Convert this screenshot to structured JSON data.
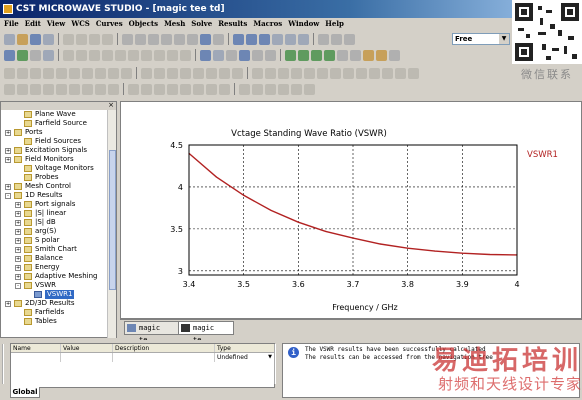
{
  "window": {
    "title": "CST MICROWAVE STUDIO - [magic tee td]"
  },
  "menu": [
    "File",
    "Edit",
    "View",
    "WCS",
    "Curves",
    "Objects",
    "Mesh",
    "Solve",
    "Results",
    "Macros",
    "Window",
    "Help"
  ],
  "toolbar": {
    "combo_value": "Free"
  },
  "watermark_top": {
    "caption": "微信联系"
  },
  "tree": {
    "items": [
      {
        "label": "Plane Wave",
        "level": 1,
        "expander": ""
      },
      {
        "label": "Farfield Source",
        "level": 1,
        "expander": ""
      },
      {
        "label": "Ports",
        "level": 0,
        "expander": "+"
      },
      {
        "label": "Field Sources",
        "level": 1,
        "expander": ""
      },
      {
        "label": "Excitation Signals",
        "level": 0,
        "expander": "+"
      },
      {
        "label": "Field Monitors",
        "level": 0,
        "expander": "+"
      },
      {
        "label": "Voltage Monitors",
        "level": 1,
        "expander": ""
      },
      {
        "label": "Probes",
        "level": 1,
        "expander": ""
      },
      {
        "label": "Mesh Control",
        "level": 0,
        "expander": "+"
      },
      {
        "label": "1D Results",
        "level": 0,
        "expander": "-"
      },
      {
        "label": "Port signals",
        "level": 1,
        "expander": "+"
      },
      {
        "label": "|S| linear",
        "level": 1,
        "expander": "+"
      },
      {
        "label": "|S| dB",
        "level": 1,
        "expander": "+"
      },
      {
        "label": "arg(S)",
        "level": 1,
        "expander": "+"
      },
      {
        "label": "S polar",
        "level": 1,
        "expander": "+"
      },
      {
        "label": "Smith Chart",
        "level": 1,
        "expander": "+"
      },
      {
        "label": "Balance",
        "level": 1,
        "expander": "+"
      },
      {
        "label": "Energy",
        "level": 1,
        "expander": "+"
      },
      {
        "label": "Adaptive Meshing",
        "level": 1,
        "expander": "+"
      },
      {
        "label": "VSWR",
        "level": 1,
        "expander": "-"
      },
      {
        "label": "VSWR1",
        "level": 2,
        "expander": "",
        "selected": true
      },
      {
        "label": "2D/3D Results",
        "level": 0,
        "expander": "+"
      },
      {
        "label": "Farfields",
        "level": 1,
        "expander": ""
      },
      {
        "label": "Tables",
        "level": 1,
        "expander": ""
      }
    ]
  },
  "tabs": [
    {
      "label": "magic te..."
    },
    {
      "label": "magic te..."
    }
  ],
  "params": {
    "columns": [
      "Name",
      "Value",
      "Description",
      "Type"
    ],
    "rows": [
      {
        "type": "Undefined"
      }
    ],
    "tab_label": "Global"
  },
  "messages": {
    "lines": [
      "The VSWR results have been successfully calculated",
      "The results can be accessed from the navigation tree"
    ]
  },
  "watermark": {
    "line1": "易迪拓培训",
    "line2": "射频和天线设计专家"
  },
  "chart_data": {
    "type": "line",
    "title": "Vctage Standing Wave Ratio (VSWR)",
    "xlabel": "Frequency / GHz",
    "ylabel": "",
    "xlim": [
      3.4,
      4.0
    ],
    "ylim": [
      2.95,
      4.5
    ],
    "xticks": [
      3.4,
      3.5,
      3.6,
      3.7,
      3.8,
      3.9,
      4
    ],
    "xtick_labels": [
      "3.4",
      "3.5",
      "3.6",
      "3.7",
      "3.8",
      "3.9",
      "4"
    ],
    "yticks": [
      3,
      3.5,
      4,
      4.5
    ],
    "ytick_labels": [
      "3",
      "3.5",
      "4",
      "4.5"
    ],
    "grid": true,
    "legend": "right",
    "series": [
      {
        "name": "VSWR1",
        "color": "#b22222",
        "x": [
          3.4,
          3.45,
          3.5,
          3.55,
          3.6,
          3.65,
          3.7,
          3.75,
          3.8,
          3.85,
          3.9,
          3.95,
          4.0
        ],
        "y": [
          4.4,
          4.12,
          3.9,
          3.72,
          3.58,
          3.47,
          3.39,
          3.32,
          3.27,
          3.235,
          3.21,
          3.195,
          3.19
        ]
      }
    ]
  }
}
